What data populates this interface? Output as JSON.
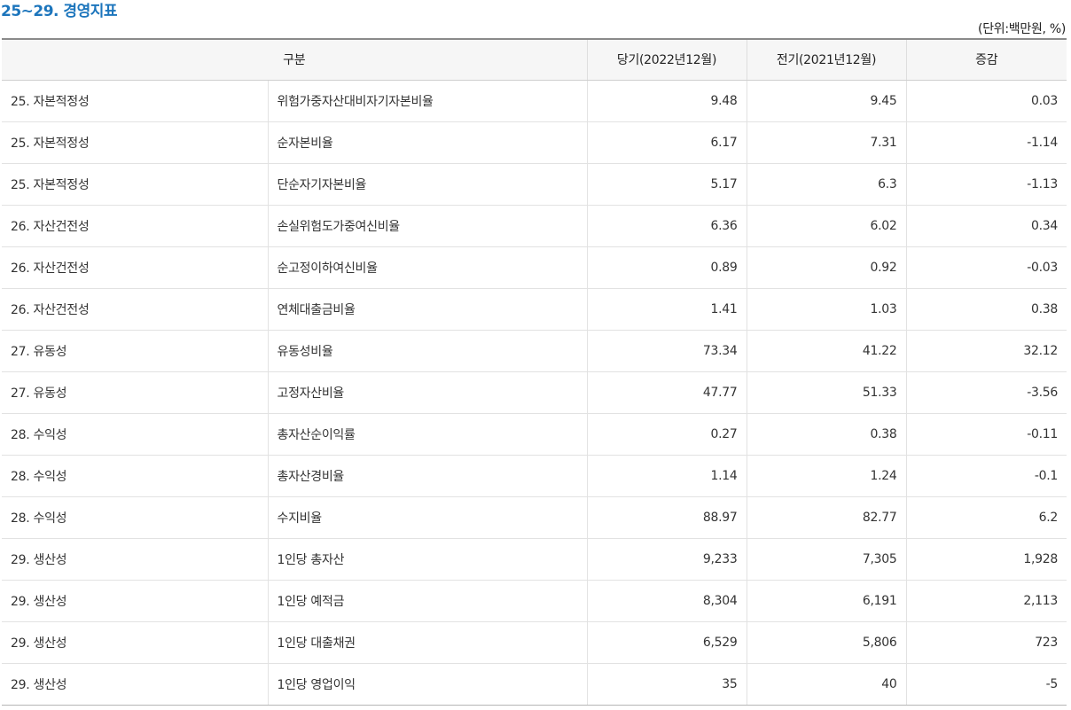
{
  "page": {
    "title": "25~29. 경영지표",
    "unit_note": "(단위:백만원, %)"
  },
  "table": {
    "headers": {
      "division": "구분",
      "current": "당기(2022년12월)",
      "previous": "전기(2021년12월)",
      "change": "증감"
    },
    "rows": [
      {
        "category": "25. 자본적정성",
        "item": "위험가중자산대비자기자본비율",
        "current": "9.48",
        "previous": "9.45",
        "change": "0.03"
      },
      {
        "category": "25. 자본적정성",
        "item": "순자본비율",
        "current": "6.17",
        "previous": "7.31",
        "change": "-1.14"
      },
      {
        "category": "25. 자본적정성",
        "item": "단순자기자본비율",
        "current": "5.17",
        "previous": "6.3",
        "change": "-1.13"
      },
      {
        "category": "26. 자산건전성",
        "item": "손실위험도가중여신비율",
        "current": "6.36",
        "previous": "6.02",
        "change": "0.34"
      },
      {
        "category": "26. 자산건전성",
        "item": "순고정이하여신비율",
        "current": "0.89",
        "previous": "0.92",
        "change": "-0.03"
      },
      {
        "category": "26. 자산건전성",
        "item": "연체대출금비율",
        "current": "1.41",
        "previous": "1.03",
        "change": "0.38"
      },
      {
        "category": "27. 유동성",
        "item": "유동성비율",
        "current": "73.34",
        "previous": "41.22",
        "change": "32.12"
      },
      {
        "category": "27. 유동성",
        "item": "고정자산비율",
        "current": "47.77",
        "previous": "51.33",
        "change": "-3.56"
      },
      {
        "category": "28. 수익성",
        "item": "총자산순이익률",
        "current": "0.27",
        "previous": "0.38",
        "change": "-0.11"
      },
      {
        "category": "28. 수익성",
        "item": "총자산경비율",
        "current": "1.14",
        "previous": "1.24",
        "change": "-0.1"
      },
      {
        "category": "28. 수익성",
        "item": "수지비율",
        "current": "88.97",
        "previous": "82.77",
        "change": "6.2"
      },
      {
        "category": "29. 생산성",
        "item": "1인당 총자산",
        "current": "9,233",
        "previous": "7,305",
        "change": "1,928"
      },
      {
        "category": "29. 생산성",
        "item": "1인당 예적금",
        "current": "8,304",
        "previous": "6,191",
        "change": "2,113"
      },
      {
        "category": "29. 생산성",
        "item": "1인당 대출채권",
        "current": "6,529",
        "previous": "5,806",
        "change": "723"
      },
      {
        "category": "29. 생산성",
        "item": "1인당 영업이익",
        "current": "35",
        "previous": "40",
        "change": "-5"
      }
    ]
  }
}
